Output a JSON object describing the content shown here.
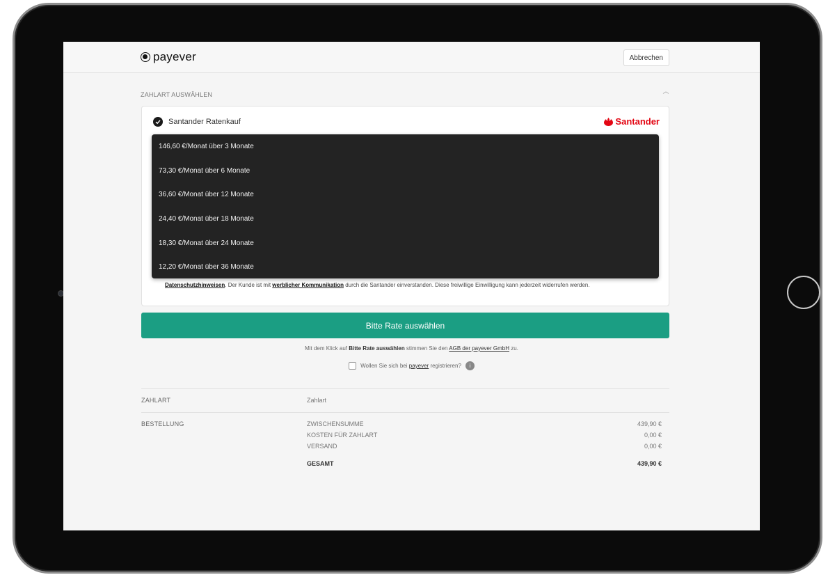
{
  "header": {
    "brand": "payever",
    "cancel_label": "Abbrechen"
  },
  "payment_section": {
    "title": "ZAHLART AUSWÄHLEN",
    "option_label": "Santander Ratenkauf",
    "provider_logo": "Santander",
    "rate_options": [
      "146,60 €/Monat über 3 Monate",
      "73,30 €/Monat über 6 Monate",
      "36,60 €/Monat über 12 Monate",
      "24,40 €/Monat über 18 Monate",
      "18,30 €/Monat über 24 Monate",
      "12,20 €/Monat über 36 Monate"
    ],
    "consent": {
      "link1": "Datenschutzhinweisen",
      "text1": ". Der Kunde ist mit ",
      "link2": "werblicher Kommunikation",
      "text2": " durch die Santander einverstanden. Diese freiwillige Einwilligung kann jederzeit widerrufen werden."
    }
  },
  "submit": {
    "label": "Bitte Rate auswählen"
  },
  "terms": {
    "prefix": "Mit dem Klick auf ",
    "bold": "Bitte Rate auswählen",
    "middle": " stimmen Sie den ",
    "link": "AGB der payever GmbH",
    "suffix": " zu."
  },
  "register": {
    "prefix": "Wollen Sie sich bei ",
    "link": "payever",
    "suffix": " registrieren?",
    "info": "i"
  },
  "summary": {
    "payment_label": "ZAHLART",
    "payment_value": "Zahlart",
    "order_label": "BESTELLUNG",
    "rows": [
      {
        "label": "ZWISCHENSUMME",
        "value": "439,90 €"
      },
      {
        "label": "KOSTEN FÜR ZAHLART",
        "value": "0,00 €"
      },
      {
        "label": "VERSAND",
        "value": "0,00 €"
      }
    ],
    "total_label": "GESAMT",
    "total_value": "439,90 €"
  },
  "colors": {
    "accent": "#1b9e83",
    "santander_red": "#e30613",
    "dropdown_bg": "#232323"
  }
}
